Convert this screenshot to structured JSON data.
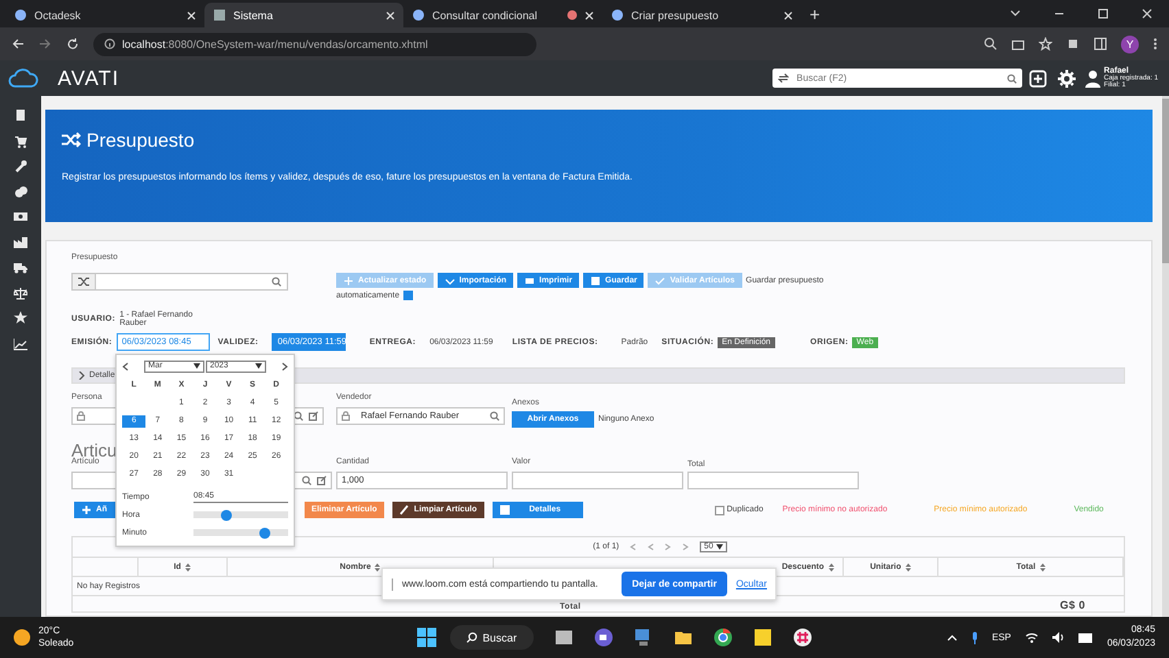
{
  "browser": {
    "tabs": [
      {
        "label": "Octadesk",
        "selected": false,
        "recording": false
      },
      {
        "label": "Sistema",
        "selected": true,
        "recording": false
      },
      {
        "label": "Consultar condicional",
        "selected": false,
        "recording": true
      },
      {
        "label": "Criar presupuesto",
        "selected": false,
        "recording": false
      }
    ],
    "new_tab": "+",
    "url_host": "localhost",
    "url_path": ":8080/OneSystem-war/menu/vendas/orcamento.xhtml",
    "profile": "Y"
  },
  "app": {
    "logo": "AVATI",
    "search": {
      "placeholder": "Buscar (F2)"
    },
    "user": {
      "name": "Rafael",
      "lines": [
        "Caja registrada: 1",
        "Filial: 1"
      ]
    }
  },
  "banner": {
    "title": "Presupuesto",
    "description": "Registrar los presupuestos informando los ítems y validez, después de eso, fature los presupuestos en la ventana de Factura Emitida."
  },
  "form": {
    "presupuesto_label": "Presupuesto",
    "buttons": [
      {
        "label": "Actualizar estado",
        "disabled": true
      },
      {
        "label": "Importación",
        "disabled": false
      },
      {
        "label": "Imprimir",
        "disabled": false
      },
      {
        "label": "Guardar",
        "disabled": false
      },
      {
        "label": "Validar Artículos",
        "disabled": true
      }
    ],
    "auto_save": {
      "label_1": "Guardar presupuesto",
      "label_2": "automaticamente",
      "checked": true
    },
    "usuario": {
      "label": "USUARIO:",
      "value": "1 - Rafael Fernando Rauber"
    },
    "emision": {
      "label": "EMISIÓN:",
      "value": "06/03/2023 08:45"
    },
    "validez": {
      "label": "VALIDEZ:",
      "value": "06/03/2023 11:59"
    },
    "entrega": {
      "label": "ENTREGA:",
      "value": "06/03/2023 11:59"
    },
    "lista": {
      "label": "LISTA DE PRECIOS:",
      "value": "Padrão"
    },
    "situacion": {
      "label": "SITUACIÓN:",
      "value": "En Definición"
    },
    "origen": {
      "label": "ORIGEN:",
      "value": "Web"
    },
    "detalles": "Detalle",
    "persona_label": "Persona",
    "vendedor": {
      "label": "Vendedor",
      "value": "Rafael Fernando Rauber"
    },
    "anexos": {
      "label": "Anexos",
      "button": "Abrir Anexos",
      "status": "Ninguno Anexo"
    },
    "articulos_heading": "Articu",
    "articulo_fields": {
      "articulo": "Artículo",
      "cantidad": "Cantidad",
      "cantidad_value": "1,000",
      "valor": "Valor",
      "total": "Total"
    },
    "article_buttons": [
      {
        "label": "Añ",
        "kind": "add"
      },
      {
        "label": "Eliminar Artículo",
        "kind": "delete"
      },
      {
        "label": "Limpiar Artículo",
        "kind": "clear"
      },
      {
        "label": "Detalles",
        "kind": "details"
      }
    ],
    "duplicado": {
      "label": "Duplicado",
      "checked": false
    },
    "legend": [
      {
        "label": "Precio mínimo no autorizado",
        "color": "#f0506e"
      },
      {
        "label": "Precio mínimo autorizado",
        "color": "#f5a623"
      },
      {
        "label": "Vendido",
        "color": "#5cb85c"
      }
    ],
    "paginator": {
      "text": "(1 of 1)",
      "page_size": "50"
    },
    "table": {
      "columns": [
        "",
        "Id",
        "Nombre",
        "Descuento",
        "Unitario",
        "Total"
      ],
      "empty": "No hay Registros",
      "footer_label": "Total",
      "footer_value": "G$ 0"
    }
  },
  "calendar": {
    "month": "Mar",
    "year": "2023",
    "weekdays": [
      "L",
      "M",
      "X",
      "J",
      "V",
      "S",
      "D"
    ],
    "days": [
      {
        "d": "1",
        "selected": false
      },
      {
        "d": "2",
        "selected": false
      },
      {
        "d": "3",
        "selected": false
      },
      {
        "d": "4",
        "selected": false
      },
      {
        "d": "5",
        "selected": false
      },
      {
        "d": "6",
        "selected": true
      },
      {
        "d": "7",
        "selected": false
      },
      {
        "d": "8",
        "selected": false
      },
      {
        "d": "9",
        "selected": false
      },
      {
        "d": "10",
        "selected": false
      },
      {
        "d": "11",
        "selected": false
      },
      {
        "d": "12",
        "selected": false
      },
      {
        "d": "13",
        "selected": false
      },
      {
        "d": "14",
        "selected": false
      },
      {
        "d": "15",
        "selected": false
      },
      {
        "d": "16",
        "selected": false
      },
      {
        "d": "17",
        "selected": false
      },
      {
        "d": "18",
        "selected": false
      },
      {
        "d": "19",
        "selected": false
      },
      {
        "d": "20",
        "selected": false
      },
      {
        "d": "21",
        "selected": false
      },
      {
        "d": "22",
        "selected": false
      },
      {
        "d": "23",
        "selected": false
      },
      {
        "d": "24",
        "selected": false
      },
      {
        "d": "25",
        "selected": false
      },
      {
        "d": "26",
        "selected": false
      },
      {
        "d": "27",
        "selected": false
      },
      {
        "d": "28",
        "selected": false
      },
      {
        "d": "29",
        "selected": false
      },
      {
        "d": "30",
        "selected": false
      },
      {
        "d": "31",
        "selected": false
      }
    ],
    "time_label": "Tiempo",
    "time": "08:45",
    "hour": {
      "label": "Hora",
      "level": 0.35
    },
    "minute": {
      "label": "Minuto",
      "level": 0.75
    }
  },
  "share_bar": {
    "message": "www.loom.com está compartiendo tu pantalla.",
    "stop": "Dejar de compartir",
    "hide": "Ocultar"
  },
  "taskbar": {
    "temperature": "20°C",
    "weather": "Soleado",
    "search": "Buscar",
    "language": "ESP",
    "time": "08:45",
    "date": "06/03/2023"
  }
}
